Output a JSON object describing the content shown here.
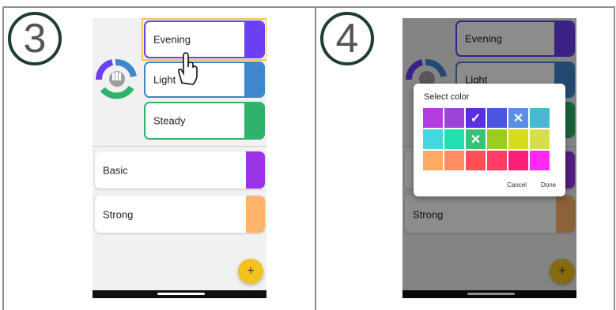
{
  "panel3": {
    "step": "3",
    "list": {
      "evening": "Evening",
      "light": "Light",
      "steady": "Steady",
      "basic": "Basic",
      "strong": "Strong"
    },
    "fab": "+"
  },
  "panel4": {
    "step": "4",
    "list": {
      "evening": "Evening",
      "light": "Light",
      "strong": "Strong"
    },
    "fab": "+",
    "dialog": {
      "title": "Select color",
      "cancel": "Cancel",
      "done": "Done",
      "colors": [
        {
          "hex": "#b33de0",
          "mark": ""
        },
        {
          "hex": "#9c44d6",
          "mark": ""
        },
        {
          "hex": "#5b2fe1",
          "mark": "check"
        },
        {
          "hex": "#4c55e0",
          "mark": ""
        },
        {
          "hex": "#5a8ee8",
          "mark": "x"
        },
        {
          "hex": "#4ab8d3",
          "mark": ""
        },
        {
          "hex": "#43d7e0",
          "mark": ""
        },
        {
          "hex": "#20e0b0",
          "mark": ""
        },
        {
          "hex": "#37c176",
          "mark": "x"
        },
        {
          "hex": "#9ccd1c",
          "mark": ""
        },
        {
          "hex": "#d8dc1d",
          "mark": ""
        },
        {
          "hex": "#d6df4a",
          "mark": ""
        },
        {
          "hex": "#ffaa62",
          "mark": ""
        },
        {
          "hex": "#ff8c62",
          "mark": ""
        },
        {
          "hex": "#ff4e55",
          "mark": ""
        },
        {
          "hex": "#ff3b66",
          "mark": ""
        },
        {
          "hex": "#ff1e76",
          "mark": ""
        },
        {
          "hex": "#ff2af0",
          "mark": ""
        }
      ]
    }
  },
  "colors": {
    "evening": "#6b3ff2",
    "light": "#3f87cc",
    "steady": "#2fb26a",
    "basic": "#9a34e6",
    "strong": "#ffb36b",
    "fab": "#f4c21c"
  }
}
